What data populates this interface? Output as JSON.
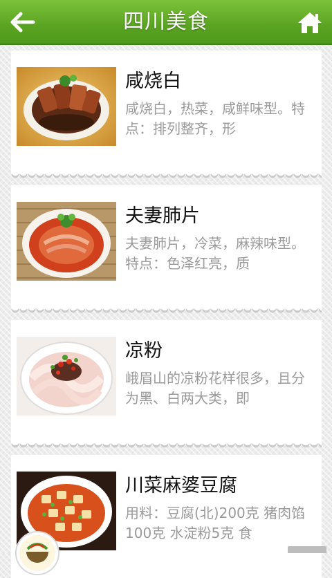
{
  "header": {
    "title": "四川美食",
    "back_icon": "arrow-left-icon",
    "home_icon": "home-icon",
    "color": "#5aa322"
  },
  "dishes": [
    {
      "name": "咸烧白",
      "desc": "咸烧白，热菜，咸鲜味型。特点：排列整齐，形"
    },
    {
      "name": "夫妻肺片",
      "desc": "夫妻肺片，冷菜，麻辣味型。特点：色泽红亮，质"
    },
    {
      "name": "凉粉",
      "desc": "峨眉山的凉粉花样很多，且分为黑、白两大类，即"
    },
    {
      "name": "川菜麻婆豆腐",
      "desc": "用料：豆腐(北)200克 猪肉馅100克 水淀粉5克 食"
    }
  ]
}
